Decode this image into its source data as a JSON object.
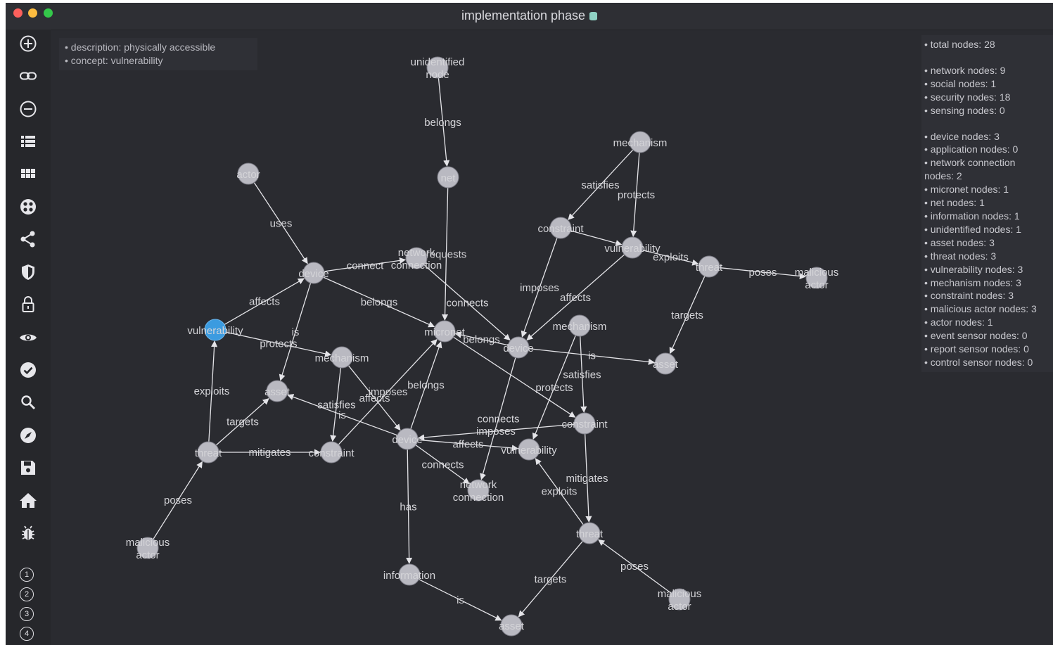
{
  "window": {
    "title": "implementation phase"
  },
  "toolbar": {
    "icons": [
      "add-circle-icon",
      "link-icon",
      "minus-circle-icon",
      "list-icon",
      "grid-icon",
      "dots-circle-icon",
      "share-icon",
      "shield-icon",
      "unlock-icon",
      "eye-icon",
      "check-circle-icon",
      "search-icon",
      "compass-icon",
      "save-icon",
      "home-icon",
      "bug-icon"
    ],
    "numbers": [
      "1",
      "2",
      "3",
      "4"
    ]
  },
  "selection_info": [
    "• description: physically accessible",
    "• concept: vulnerability"
  ],
  "stats": {
    "total": "• total nodes: 28",
    "group1": [
      "• network nodes: 9",
      "• social nodes: 1",
      "• security nodes: 18",
      "• sensing nodes: 0"
    ],
    "group2": [
      "• device nodes: 3",
      "• application nodes: 0",
      "• network connection",
      "nodes: 2",
      "• micronet nodes: 1",
      "• net nodes: 1",
      "• information nodes: 1",
      "• unidentified nodes: 1",
      "• asset nodes: 3",
      "• threat nodes: 3",
      "• vulnerability nodes: 3",
      "• mechanism nodes: 3",
      "• constraint nodes: 3",
      "• malicious actor nodes: 3",
      "• actor nodes: 1",
      "• event sensor nodes: 0",
      "• report sensor nodes: 0",
      "• control sensor nodes: 0"
    ]
  },
  "graph": {
    "nodes": [
      {
        "id": "unidentified",
        "label": "unidentified node",
        "label_lines": [
          "unidentified",
          "node"
        ]
      },
      {
        "id": "net",
        "label": "net",
        "label_lines": [
          "net"
        ]
      },
      {
        "id": "actor",
        "label": "actor",
        "label_lines": [
          "actor"
        ]
      },
      {
        "id": "mechanism1",
        "label": "mechanism",
        "label_lines": [
          "mechanism"
        ]
      },
      {
        "id": "constraint1",
        "label": "constraint",
        "label_lines": [
          "constraint"
        ]
      },
      {
        "id": "vulnerability1",
        "label": "vulnerability",
        "label_lines": [
          "vulnerability"
        ]
      },
      {
        "id": "threat1",
        "label": "threat",
        "label_lines": [
          "threat"
        ]
      },
      {
        "id": "malicious1",
        "label": "malicious actor",
        "label_lines": [
          "malicious",
          "actor"
        ]
      },
      {
        "id": "device1",
        "label": "device",
        "label_lines": [
          "device"
        ]
      },
      {
        "id": "netconn1",
        "label": "network connection",
        "label_lines": [
          "network",
          "connection"
        ]
      },
      {
        "id": "micronet",
        "label": "micronet",
        "label_lines": [
          "micronet"
        ]
      },
      {
        "id": "vulnerability_sel",
        "label": "vulnerability",
        "label_lines": [
          "vulnerability"
        ],
        "selected": true
      },
      {
        "id": "mechanism2",
        "label": "mechanism",
        "label_lines": [
          "mechanism"
        ]
      },
      {
        "id": "asset1",
        "label": "asset",
        "label_lines": [
          "asset"
        ]
      },
      {
        "id": "mechanism3",
        "label": "mechanism",
        "label_lines": [
          "mechanism"
        ]
      },
      {
        "id": "device2",
        "label": "device",
        "label_lines": [
          "device"
        ]
      },
      {
        "id": "asset2",
        "label": "asset",
        "label_lines": [
          "asset"
        ]
      },
      {
        "id": "threat2",
        "label": "threat",
        "label_lines": [
          "threat"
        ]
      },
      {
        "id": "constraint2",
        "label": "constraint",
        "label_lines": [
          "constraint"
        ]
      },
      {
        "id": "device3",
        "label": "device",
        "label_lines": [
          "device"
        ]
      },
      {
        "id": "vulnerability3",
        "label": "vulnerability",
        "label_lines": [
          "vulnerability"
        ]
      },
      {
        "id": "constraint3",
        "label": "constraint",
        "label_lines": [
          "constraint"
        ]
      },
      {
        "id": "netconn2",
        "label": "network connection",
        "label_lines": [
          "network",
          "connection"
        ]
      },
      {
        "id": "malicious2",
        "label": "malicious actor",
        "label_lines": [
          "malicious",
          "actor"
        ]
      },
      {
        "id": "threat3",
        "label": "threat",
        "label_lines": [
          "threat"
        ]
      },
      {
        "id": "information",
        "label": "information",
        "label_lines": [
          "information"
        ]
      },
      {
        "id": "asset3",
        "label": "asset",
        "label_lines": [
          "asset"
        ]
      },
      {
        "id": "malicious3",
        "label": "malicious actor",
        "label_lines": [
          "malicious",
          "actor"
        ]
      }
    ],
    "edges": [
      {
        "from": "unidentified",
        "to": "net",
        "label": "belongs"
      },
      {
        "from": "net",
        "to": "micronet",
        "label": "requests"
      },
      {
        "from": "actor",
        "to": "device1",
        "label": "uses"
      },
      {
        "from": "mechanism1",
        "to": "constraint1",
        "label": "satisfies"
      },
      {
        "from": "mechanism1",
        "to": "vulnerability1",
        "label": "protects"
      },
      {
        "from": "constraint1",
        "to": "vulnerability1",
        "label": ""
      },
      {
        "from": "constraint1",
        "to": "device2",
        "label": "imposes"
      },
      {
        "from": "vulnerability1",
        "to": "device2",
        "label": "affects"
      },
      {
        "from": "vulnerability1",
        "to": "threat1",
        "label": "exploits"
      },
      {
        "from": "threat1",
        "to": "malicious1",
        "label": "poses"
      },
      {
        "from": "threat1",
        "to": "asset2",
        "label": "targets"
      },
      {
        "from": "device1",
        "to": "micronet",
        "label": "belongs"
      },
      {
        "from": "device1",
        "to": "netconn1",
        "label": "connect"
      },
      {
        "from": "netconn1",
        "to": "device2",
        "label": "connects"
      },
      {
        "from": "vulnerability_sel",
        "to": "device1",
        "label": "affects"
      },
      {
        "from": "device1",
        "to": "asset1",
        "label": "is"
      },
      {
        "from": "vulnerability_sel",
        "to": "mechanism2",
        "label": "protects"
      },
      {
        "from": "threat2",
        "to": "vulnerability_sel",
        "label": "exploits"
      },
      {
        "from": "threat2",
        "to": "asset1",
        "label": "targets"
      },
      {
        "from": "malicious2",
        "to": "threat2",
        "label": "poses"
      },
      {
        "from": "threat2",
        "to": "constraint2",
        "label": "mitigates"
      },
      {
        "from": "mechanism2",
        "to": "constraint2",
        "label": "satisfies"
      },
      {
        "from": "mechanism2",
        "to": "device3",
        "label": "affects"
      },
      {
        "from": "constraint2",
        "to": "micronet",
        "label": "imposes"
      },
      {
        "from": "device3",
        "to": "micronet",
        "label": "belongs"
      },
      {
        "from": "device3",
        "to": "asset1",
        "label": "is"
      },
      {
        "from": "device2",
        "to": "micronet",
        "label": "belongs"
      },
      {
        "from": "device2",
        "to": "asset2",
        "label": "is"
      },
      {
        "from": "device3",
        "to": "vulnerability3",
        "label": "affects"
      },
      {
        "from": "device3",
        "to": "netconn2",
        "label": "connects"
      },
      {
        "from": "device3",
        "to": "information",
        "label": "has"
      },
      {
        "from": "mechanism3",
        "to": "vulnerability3",
        "label": "protects"
      },
      {
        "from": "mechanism3",
        "to": "constraint3",
        "label": "satisfies"
      },
      {
        "from": "constraint3",
        "to": "device3",
        "label": "imposes"
      },
      {
        "from": "micronet",
        "to": "constraint3",
        "label": ""
      },
      {
        "from": "device2",
        "to": "netconn2",
        "label": "connects"
      },
      {
        "from": "constraint3",
        "to": "threat3",
        "label": "mitigates"
      },
      {
        "from": "threat3",
        "to": "vulnerability3",
        "label": "exploits"
      },
      {
        "from": "malicious3",
        "to": "threat3",
        "label": "poses"
      },
      {
        "from": "threat3",
        "to": "asset3",
        "label": "targets"
      },
      {
        "from": "information",
        "to": "asset3",
        "label": "is"
      }
    ]
  },
  "colors": {
    "background": "#2a2b30",
    "node": "#b9b9c1",
    "selected_node": "#3b9be0",
    "edge": "#e4e4e8"
  }
}
